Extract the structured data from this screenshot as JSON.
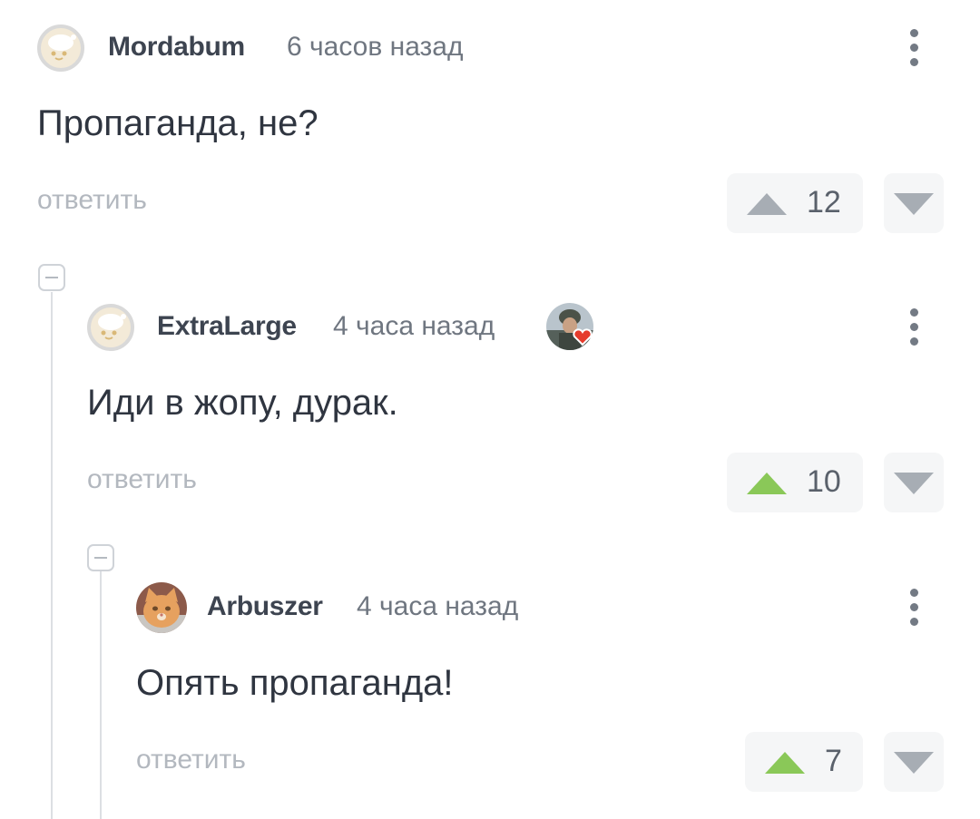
{
  "colors": {
    "upvote_active": "#8ac858",
    "upvote_inactive": "#a7adb4",
    "downvote": "#a7adb4",
    "vote_bg": "#f5f6f7",
    "reply_text": "#b3b8bf"
  },
  "comments": [
    {
      "username": "Mordabum",
      "time": "6 часов назад",
      "text": "Пропаганда, не?",
      "reply_label": "ответить",
      "votes": "12",
      "upvoted": false,
      "avatar": "default-avatar-icon"
    },
    {
      "username": "ExtraLarge",
      "time": "4 часа назад",
      "text": "Иди в жопу, дурак.",
      "reply_label": "ответить",
      "votes": "10",
      "upvoted": true,
      "avatar": "default-avatar-icon",
      "badge": "soldier-heart-badge-icon"
    },
    {
      "username": "Arbuszer",
      "time": "4 часа назад",
      "text": "Опять пропаганда!",
      "reply_label": "ответить",
      "votes": "7",
      "upvoted": true,
      "avatar": "cat-avatar-icon"
    }
  ]
}
